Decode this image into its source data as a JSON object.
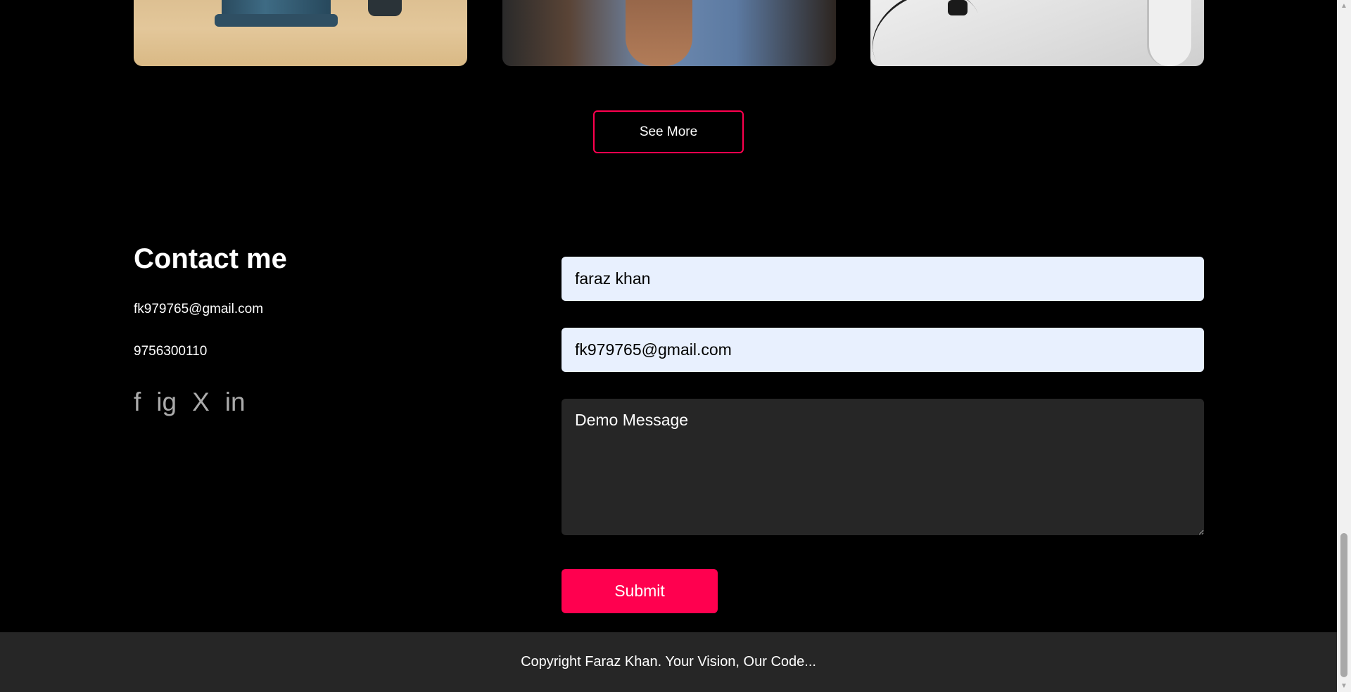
{
  "portfolio": {
    "see_more_label": "See More"
  },
  "contact": {
    "title": "Contact me",
    "email": "fk979765@gmail.com",
    "phone": "9756300110",
    "socials": [
      {
        "icon": "facebook-icon",
        "glyph": "f"
      },
      {
        "icon": "instagram-icon",
        "glyph": "ig"
      },
      {
        "icon": "x-twitter-icon",
        "glyph": "X"
      },
      {
        "icon": "linkedin-icon",
        "glyph": "in"
      }
    ]
  },
  "form": {
    "name_value": "faraz khan",
    "email_value": "fk979765@gmail.com",
    "message_value": "Demo Message",
    "submit_label": "Submit"
  },
  "footer": {
    "copyright": "Copyright Faraz Khan. Your Vision, Our Code..."
  },
  "colors": {
    "accent": "#ff004f",
    "background": "#000000",
    "footer_bg": "#262626",
    "input_autofill_bg": "#e8f0fe"
  }
}
